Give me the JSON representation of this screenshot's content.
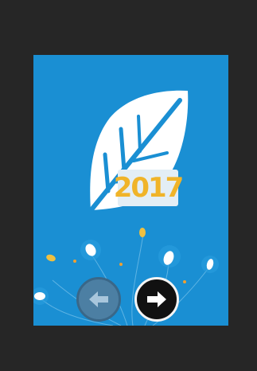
{
  "viewer": {
    "background_color": "#262626"
  },
  "slide": {
    "background_color": "#1a8fd3",
    "leaf_icon": "leaf-icon",
    "year_label": "2017",
    "year_color": "#f0b429"
  },
  "navigation": {
    "previous_icon": "arrow-left-icon",
    "next_icon": "arrow-right-icon"
  }
}
